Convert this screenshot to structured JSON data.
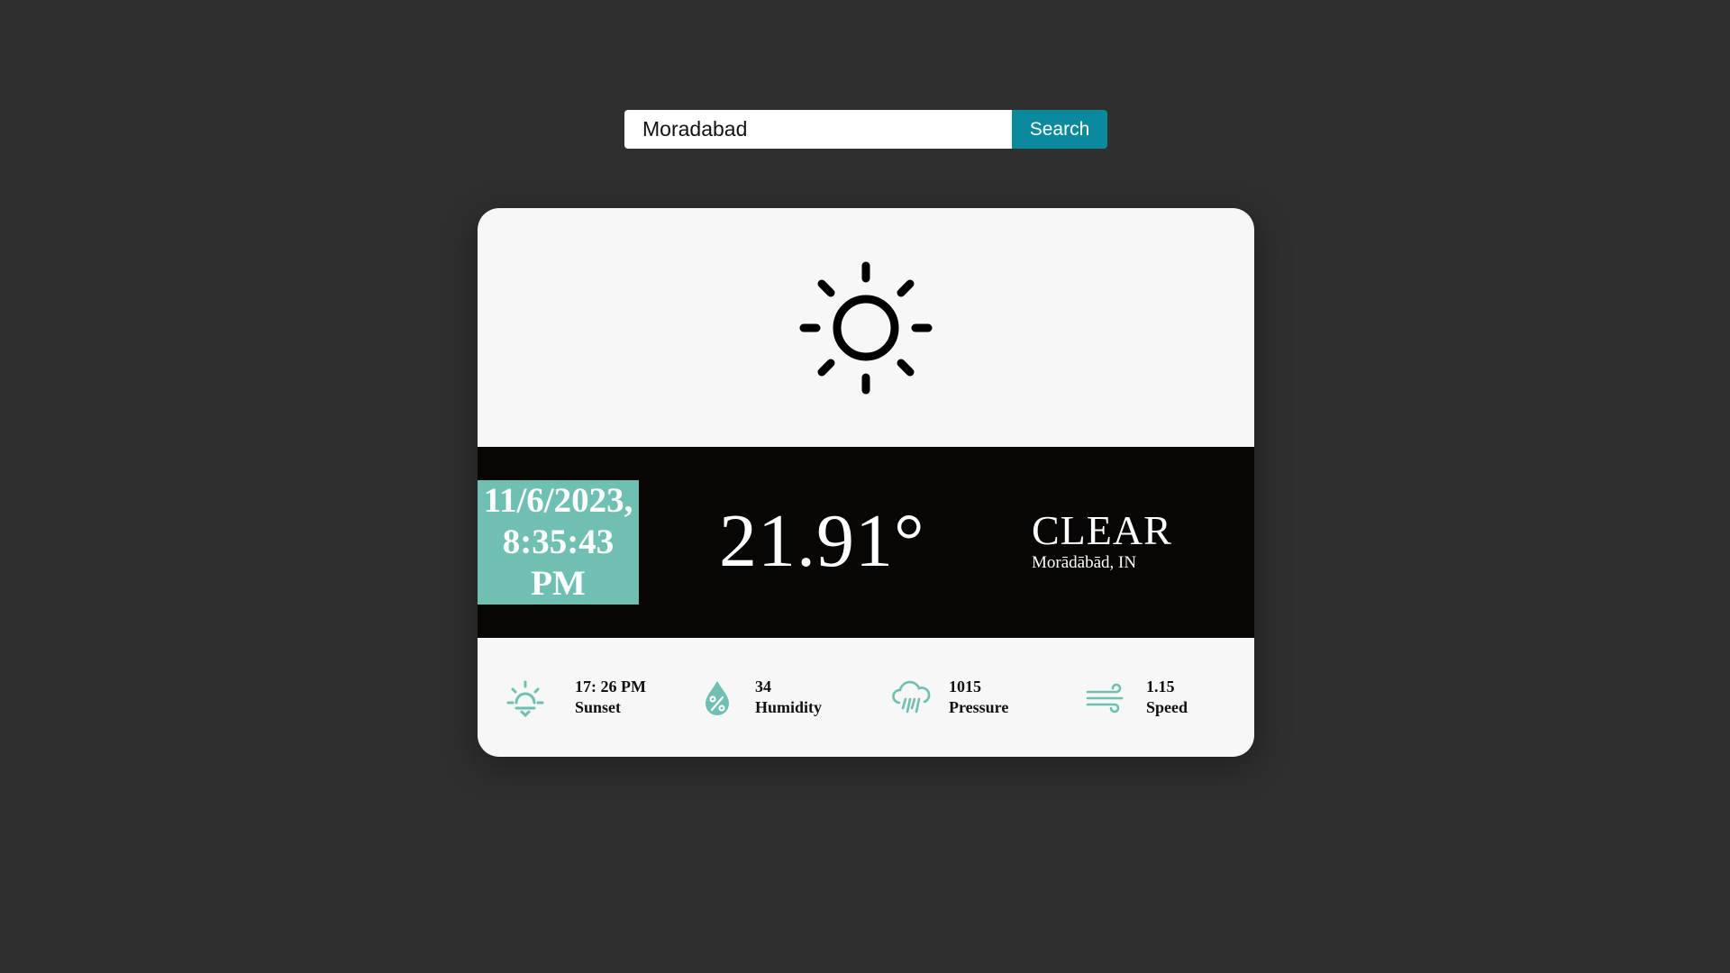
{
  "search": {
    "value": "Moradabad",
    "button_label": "Search"
  },
  "weather": {
    "icon": "sun-icon",
    "datetime": {
      "date": "11/6/2023,",
      "time": "8:35:43",
      "ampm": "PM"
    },
    "temperature": "21.91°",
    "condition": "CLEAR",
    "location": "Morādābād, IN"
  },
  "stats": [
    {
      "icon": "sunset-icon",
      "value": "17: 26 PM",
      "label": "Sunset"
    },
    {
      "icon": "humidity-icon",
      "value": "34",
      "label": "Humidity"
    },
    {
      "icon": "pressure-icon",
      "value": "1015",
      "label": "Pressure"
    },
    {
      "icon": "wind-icon",
      "value": "1.15",
      "label": "Speed"
    }
  ],
  "colors": {
    "background": "#2f2f2f",
    "card": "#f7f7f7",
    "band": "#070605",
    "accent": "#6fbfb3",
    "button": "#0b8a9e"
  }
}
